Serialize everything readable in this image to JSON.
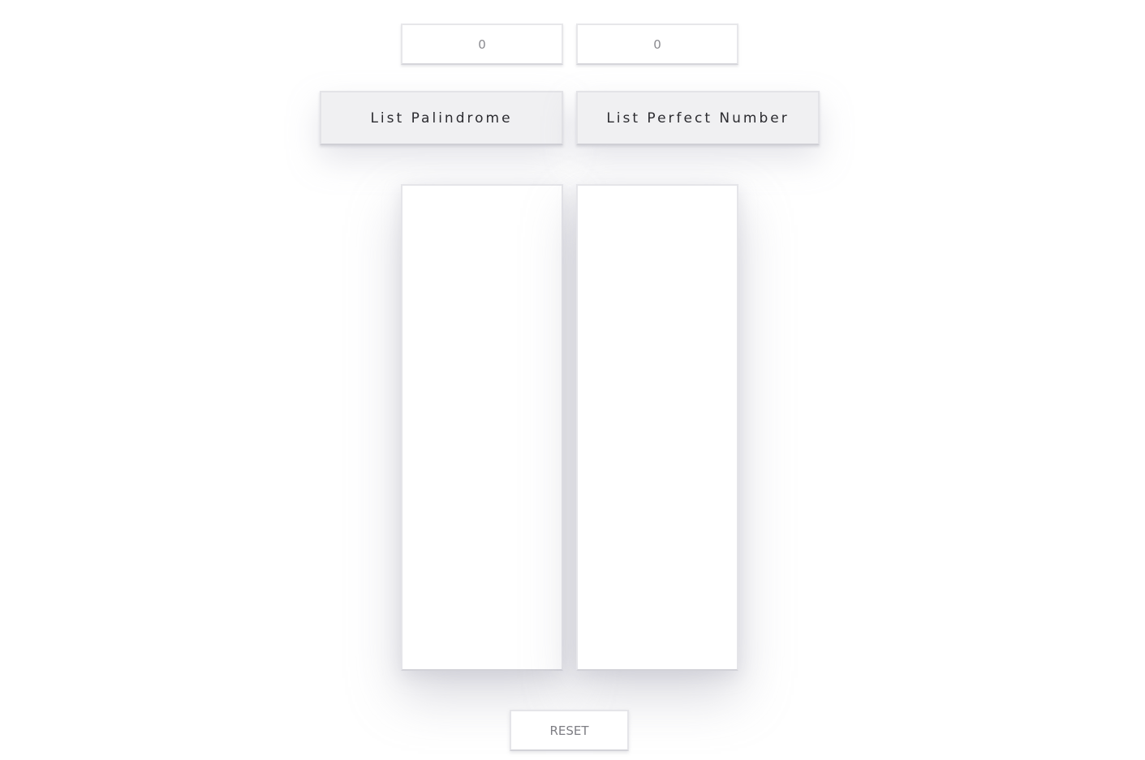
{
  "inputs": {
    "left_value": "0",
    "right_value": "0"
  },
  "buttons": {
    "palindrome_label": "List Palindrome",
    "perfect_number_label": "List Perfect Number",
    "reset_label": "RESET"
  },
  "results": {
    "palindrome_list": "",
    "perfect_number_list": ""
  }
}
